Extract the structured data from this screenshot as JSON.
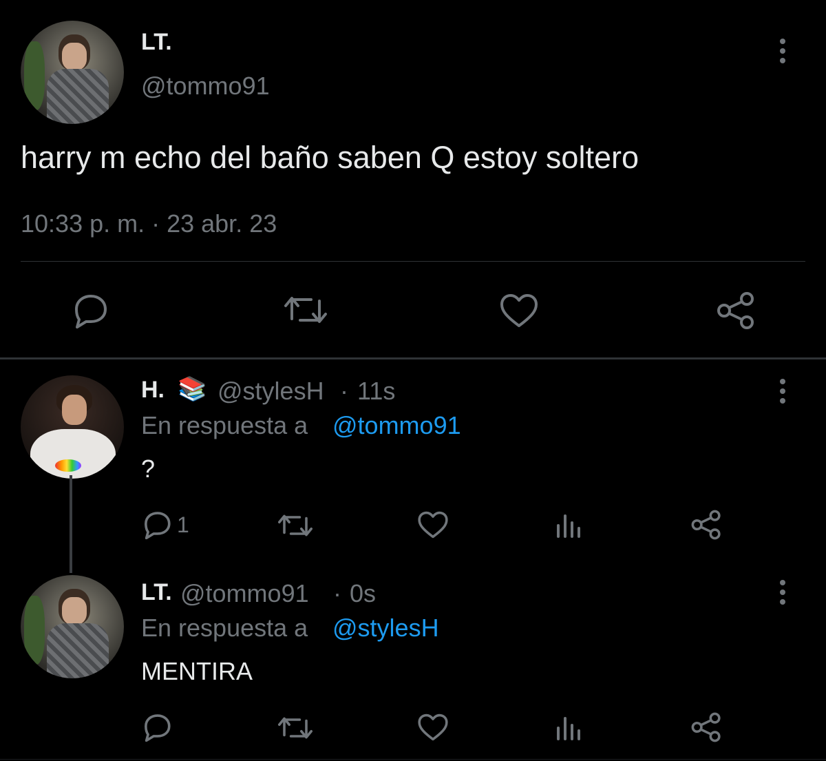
{
  "main_tweet": {
    "display_name": "LT.",
    "handle": "@tommo91",
    "text": "harry m echo del baño saben Q estoy soltero",
    "timestamp": "10:33 p. m. · 23 abr. 23",
    "actions": [
      "reply-icon",
      "retweet-icon",
      "like-icon",
      "share-icon"
    ]
  },
  "replies": [
    {
      "display_name": "H.",
      "badge_emoji": "📚",
      "handle": "@stylesH",
      "time": "11s",
      "in_reply_prefix": "En respuesta a",
      "in_reply_to": "@tommo91",
      "text": "?",
      "reply_count": "1",
      "actions": [
        "reply-icon",
        "retweet-icon",
        "like-icon",
        "views-icon",
        "share-icon"
      ]
    },
    {
      "display_name": "LT.",
      "handle": "@tommo91",
      "time": "0s",
      "in_reply_prefix": "En respuesta a",
      "in_reply_to": "@stylesH",
      "text": "MENTIRA",
      "reply_count": "",
      "actions": [
        "reply-icon",
        "retweet-icon",
        "like-icon",
        "views-icon",
        "share-icon"
      ]
    }
  ],
  "colors": {
    "background": "#000000",
    "text": "#e7e9ea",
    "muted": "#71767b",
    "link": "#1d9bf0",
    "divider": "#2f3336"
  }
}
